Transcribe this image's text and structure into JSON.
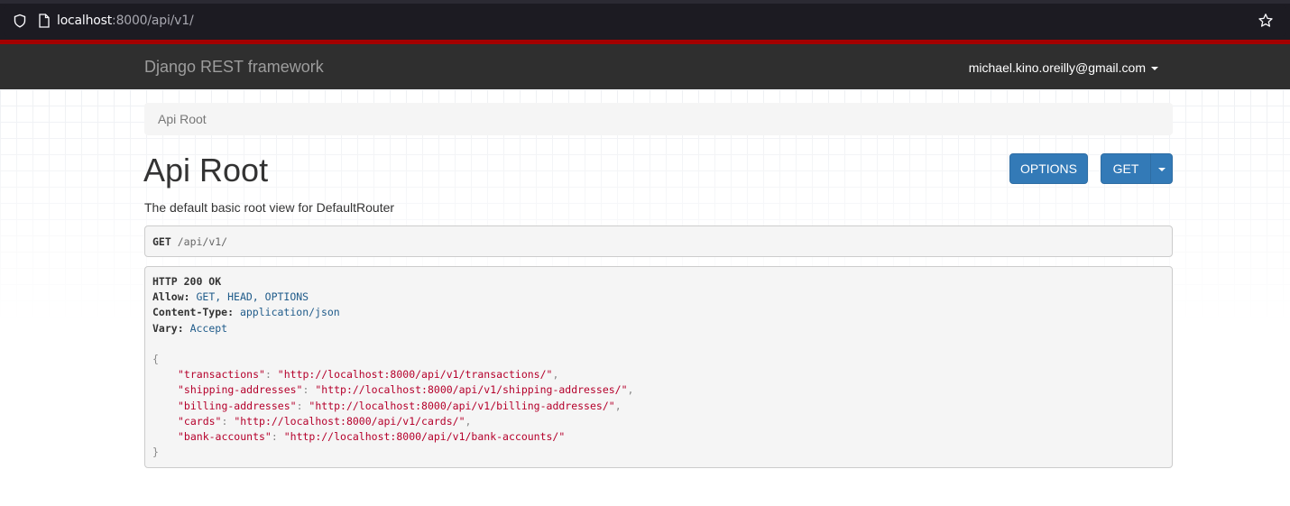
{
  "browser": {
    "url_host": "localhost",
    "url_rest": ":8000/api/v1/"
  },
  "navbar": {
    "brand": "Django REST framework",
    "user_email": "michael.kino.oreilly@gmail.com"
  },
  "breadcrumb": {
    "current": "Api Root"
  },
  "page": {
    "title": "Api Root",
    "description": "The default basic root view for DefaultRouter",
    "options_label": "OPTIONS",
    "get_label": "GET"
  },
  "request": {
    "method": "GET",
    "path": "/api/v1/"
  },
  "response": {
    "status": "HTTP 200 OK",
    "headers": [
      {
        "key": "Allow:",
        "value": "GET, HEAD, OPTIONS"
      },
      {
        "key": "Content-Type:",
        "value": "application/json"
      },
      {
        "key": "Vary:",
        "value": "Accept"
      }
    ],
    "open_brace": "{",
    "close_brace": "}",
    "body": [
      {
        "key": "\"transactions\"",
        "value": "\"http://localhost:8000/api/v1/transactions/\"",
        "sep": ","
      },
      {
        "key": "\"shipping-addresses\"",
        "value": "\"http://localhost:8000/api/v1/shipping-addresses/\"",
        "sep": ","
      },
      {
        "key": "\"billing-addresses\"",
        "value": "\"http://localhost:8000/api/v1/billing-addresses/\"",
        "sep": ","
      },
      {
        "key": "\"cards\"",
        "value": "\"http://localhost:8000/api/v1/cards/\"",
        "sep": ","
      },
      {
        "key": "\"bank-accounts\"",
        "value": "\"http://localhost:8000/api/v1/bank-accounts/\"",
        "sep": ""
      }
    ]
  },
  "colors": {
    "navbar_accent": "#a30000",
    "button": "#337ab7"
  }
}
